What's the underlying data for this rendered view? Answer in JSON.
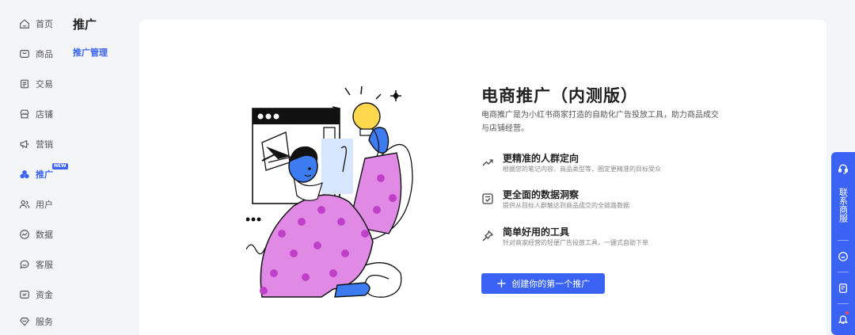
{
  "nav": {
    "items": [
      {
        "label": "首页",
        "icon": "home-icon"
      },
      {
        "label": "商品",
        "icon": "product-icon"
      },
      {
        "label": "交易",
        "icon": "trade-icon"
      },
      {
        "label": "店铺",
        "icon": "store-icon"
      },
      {
        "label": "营销",
        "icon": "megaphone-icon"
      },
      {
        "label": "推广",
        "icon": "promotion-icon",
        "active": true,
        "badge": "NEW"
      },
      {
        "label": "用户",
        "icon": "users-icon"
      },
      {
        "label": "数据",
        "icon": "data-icon"
      },
      {
        "label": "客服",
        "icon": "chat-icon"
      },
      {
        "label": "资金",
        "icon": "wallet-icon"
      },
      {
        "label": "服务",
        "icon": "service-icon"
      }
    ]
  },
  "subnav": {
    "title": "推广",
    "item": "推广管理"
  },
  "main": {
    "headline": "电商推广（内测版）",
    "description": "电商推广是为小红书商家打造的自助化广告投放工具，助力商品成交与店铺经营。",
    "features": [
      {
        "title": "更精准的人群定向",
        "subtitle": "根据您的笔记内容、商品类型等，圈定更精准的目标受众",
        "icon": "trend-up-icon"
      },
      {
        "title": "更全面的数据洞察",
        "subtitle": "提供从目标人群触达到商品成交的全链路数据",
        "icon": "data-insight-icon"
      },
      {
        "title": "简单好用的工具",
        "subtitle": "针对商家经营的轻便广告投放工具，一键式自助下单",
        "icon": "pin-icon"
      }
    ],
    "cta_label": "创建你的第一个推广"
  },
  "floatbar": {
    "contact_label": "联系商服"
  },
  "colors": {
    "accent": "#3a63f3",
    "background": "#f4f5f7",
    "card": "#ffffff",
    "illustration_pink": "#e08ae6",
    "illustration_blue": "#3d7bf0",
    "illustration_yellow": "#ffd84d"
  }
}
